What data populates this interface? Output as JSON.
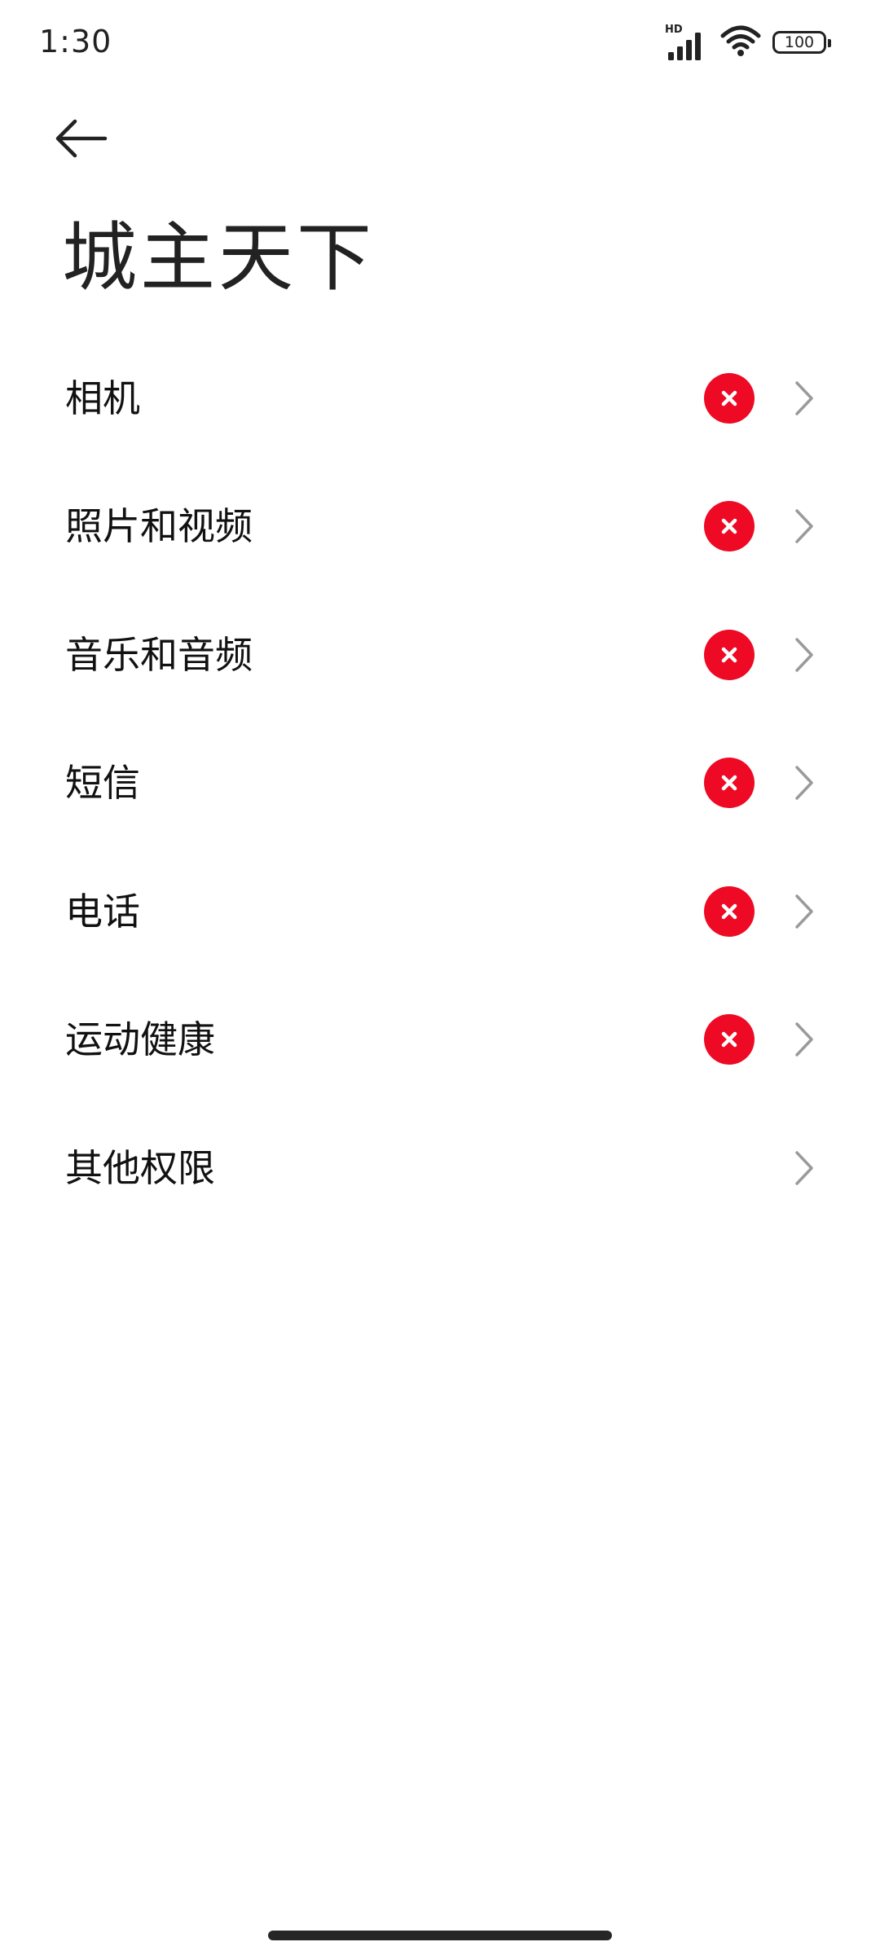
{
  "status_bar": {
    "time": "1:30",
    "network_label": "HD",
    "battery_level": "100",
    "icons": [
      "signal-icon",
      "wifi-icon",
      "battery-icon"
    ]
  },
  "header": {
    "back_icon": "back-arrow-icon",
    "title": "城主天下"
  },
  "permissions": [
    {
      "label": "相机",
      "status": "denied"
    },
    {
      "label": "照片和视频",
      "status": "denied"
    },
    {
      "label": "音乐和音频",
      "status": "denied"
    },
    {
      "label": "短信",
      "status": "denied"
    },
    {
      "label": "电话",
      "status": "denied"
    },
    {
      "label": "运动健康",
      "status": "denied"
    },
    {
      "label": "其他权限",
      "status": "none"
    }
  ],
  "colors": {
    "deny_badge": "#ee0a24",
    "chevron": "#9a9a9a",
    "text": "#111111"
  }
}
